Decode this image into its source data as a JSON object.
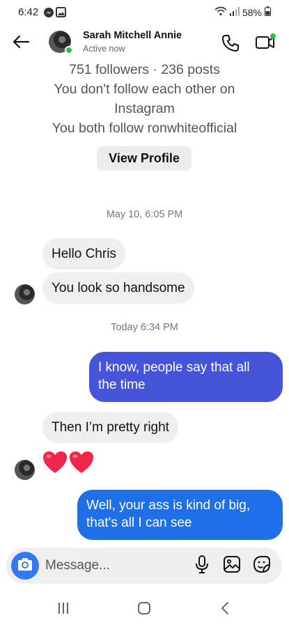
{
  "status_bar": {
    "time": "6:42",
    "battery": "58%"
  },
  "header": {
    "contact_name": "Sarah Mitchell Annie",
    "contact_status": "Active now"
  },
  "profile": {
    "followers_posts": "751 followers · 236 posts",
    "follow_relation_line1": "You don't follow each other on",
    "follow_relation_line2": "Instagram",
    "mutual": "You both follow ronwhiteofficial",
    "view_profile_label": "View Profile"
  },
  "messages": [
    {
      "type": "timestamp",
      "text": "May 10, 6:05 PM"
    },
    {
      "type": "incoming",
      "text": "Hello Chris"
    },
    {
      "type": "incoming",
      "text": "You look so handsome"
    },
    {
      "type": "timestamp",
      "text": "Today 6:34 PM"
    },
    {
      "type": "outgoing",
      "line1": "I know, people say that all",
      "line2": "the time"
    },
    {
      "type": "incoming",
      "text": "Then I’m pretty right"
    },
    {
      "type": "incoming-emoji",
      "text": "❤❤"
    },
    {
      "type": "outgoing",
      "line1": "Well, your ass is kind of big,",
      "line2": "that's all I can see"
    }
  ],
  "composer": {
    "placeholder": "Message..."
  },
  "colors": {
    "outgoing_bubble_1": "#4554d8",
    "outgoing_bubble_2": "#1f6fe8",
    "incoming_bubble": "#efefef",
    "camera_button": "#3478f6",
    "online_dot": "#2fbf45",
    "heart": "#f0264a"
  }
}
